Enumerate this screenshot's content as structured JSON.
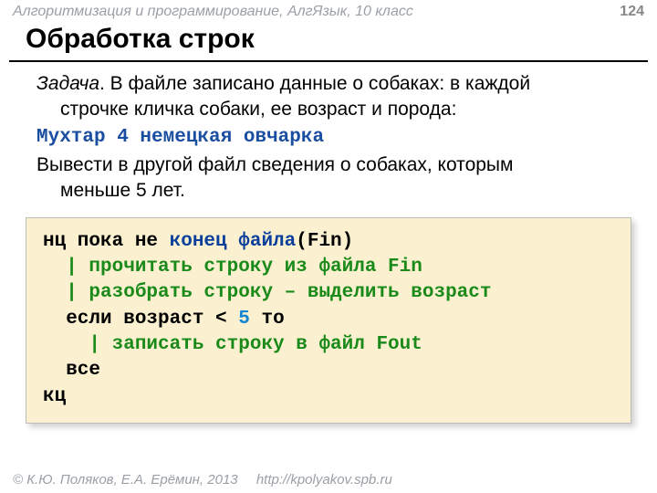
{
  "header": {
    "course": "Алгоритмизация и программирование, АлгЯзык, 10 класс",
    "page": "124"
  },
  "title": "Обработка строк",
  "task": {
    "label": "Задача",
    "dot": ". ",
    "line1a": "В файле записано данные о собаках: в каждой",
    "line1b": "строчке кличка собаки, ее возраст и порода:",
    "example": "Мухтар 4 немецкая овчарка",
    "line2a": "Вывести в другой файл сведения о собаках, которым",
    "line2b": "меньше 5 лет."
  },
  "code": {
    "l1_kw": "нц пока не ",
    "l1_fn": "конец файла",
    "l1_rest": "(Fin)",
    "l2": "  | прочитать строку из файла Fin",
    "l3": "  | разобрать строку – выделить возраст",
    "l4_a": "  если возраст < ",
    "l4_num": "5",
    "l4_b": " то",
    "l5": "    | записать строку в файл Fout",
    "l6": "  все",
    "l7": "кц"
  },
  "footer": {
    "copyright": "© К.Ю. Поляков, Е.А. Ерёмин, 2013",
    "url": "http://kpolyakov.spb.ru"
  }
}
